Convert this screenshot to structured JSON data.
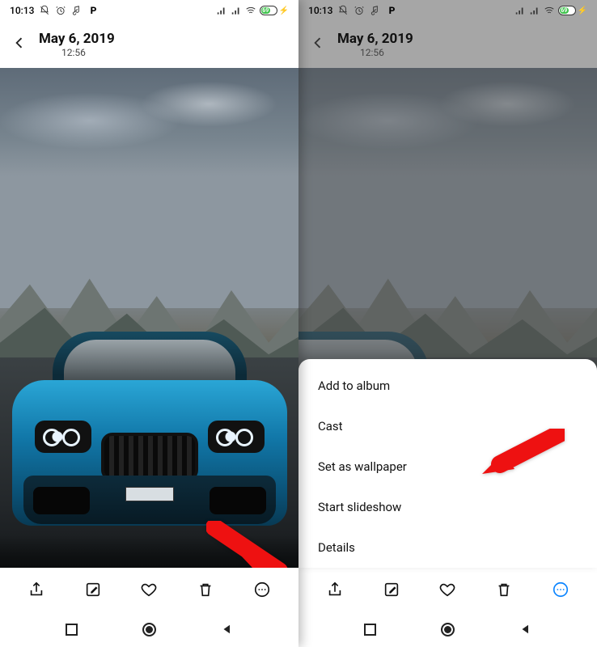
{
  "status": {
    "time": "10:13",
    "icons_left": [
      "bell-off-icon",
      "alarm-icon",
      "music-note-icon",
      "letter-p-icon"
    ],
    "battery_text": "69"
  },
  "header": {
    "date": "May 6, 2019",
    "time": "12:56"
  },
  "toolbar": {
    "share": "Share",
    "edit": "Edit",
    "favorite": "Favorite",
    "delete": "Delete",
    "more": "More"
  },
  "sheet": {
    "items": [
      {
        "label": "Add to album"
      },
      {
        "label": "Cast"
      },
      {
        "label": "Set as wallpaper"
      },
      {
        "label": "Start slideshow"
      },
      {
        "label": "Details"
      }
    ]
  }
}
